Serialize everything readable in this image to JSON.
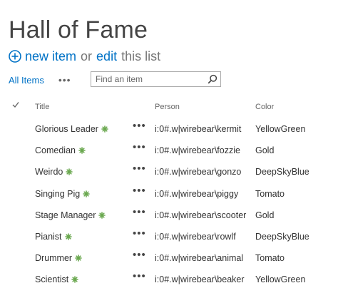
{
  "page": {
    "title": "Hall of Fame"
  },
  "command_bar": {
    "new_item_label": "new item",
    "or_text": "or",
    "edit_label": "edit",
    "this_list_text": "this list"
  },
  "view_bar": {
    "view_label": "All Items",
    "menu_label": "•••",
    "search_placeholder": "Find an item"
  },
  "table": {
    "columns": {
      "title": "Title",
      "person": "Person",
      "color": "Color"
    },
    "ellipsis": "•••",
    "rows": [
      {
        "title": "Glorious Leader",
        "person": "i:0#.w|wirebear\\kermit",
        "color": "YellowGreen"
      },
      {
        "title": "Comedian",
        "person": "i:0#.w|wirebear\\fozzie",
        "color": "Gold"
      },
      {
        "title": "Weirdo",
        "person": "i:0#.w|wirebear\\gonzo",
        "color": "DeepSkyBlue"
      },
      {
        "title": "Singing Pig",
        "person": "i:0#.w|wirebear\\piggy",
        "color": "Tomato"
      },
      {
        "title": "Stage Manager",
        "person": "i:0#.w|wirebear\\scooter",
        "color": "Gold"
      },
      {
        "title": "Pianist",
        "person": "i:0#.w|wirebear\\rowlf",
        "color": "DeepSkyBlue"
      },
      {
        "title": "Drummer",
        "person": "i:0#.w|wirebear\\animal",
        "color": "Tomato"
      },
      {
        "title": "Scientist",
        "person": "i:0#.w|wirebear\\beaker",
        "color": "YellowGreen"
      }
    ]
  },
  "icons": {
    "new_item": "plus-circle-icon",
    "search": "magnifier-icon",
    "new_badge": "new-item-glyph-icon",
    "check_header": "checkmark-icon"
  },
  "colors": {
    "link": "#0072c6",
    "title_text": "#444444",
    "new_badge": "#6aa84f"
  }
}
